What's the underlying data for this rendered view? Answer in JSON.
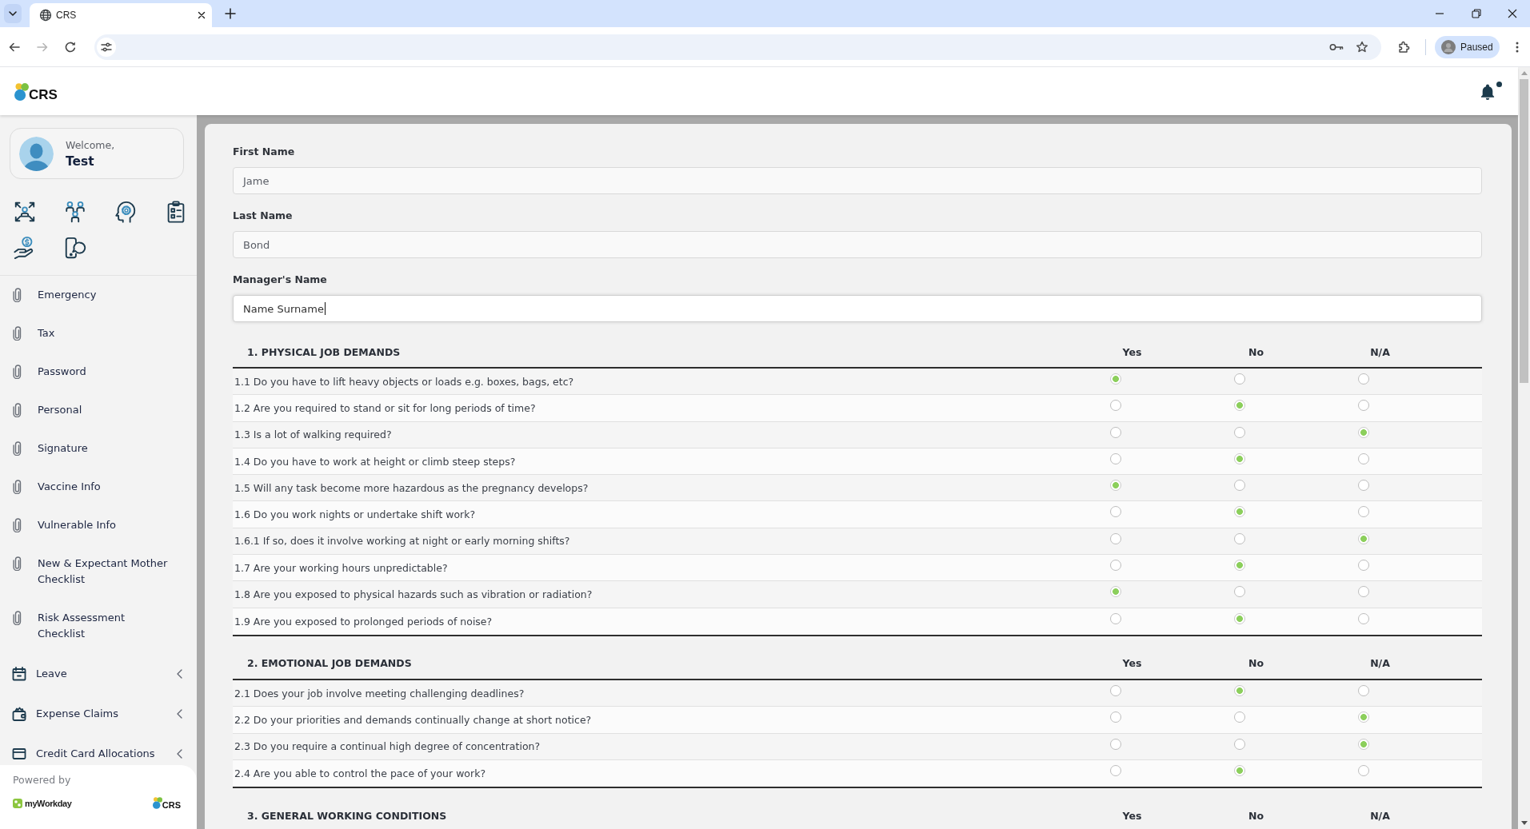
{
  "browser": {
    "tabs": [
      {
        "title": "CRS",
        "selected": true
      }
    ],
    "forward_disabled": true,
    "profile": {
      "status": "Paused"
    }
  },
  "header": {
    "logo": "CRS",
    "notifications": {
      "unread": true
    }
  },
  "sidebar": {
    "welcome": {
      "greeting": "Welcome,",
      "name": "Test"
    },
    "items": [
      {
        "kind": "attachment",
        "label": "Emergency"
      },
      {
        "kind": "attachment",
        "label": "Tax"
      },
      {
        "kind": "attachment",
        "label": "Password"
      },
      {
        "kind": "attachment",
        "label": "Personal"
      },
      {
        "kind": "attachment",
        "label": "Signature"
      },
      {
        "kind": "attachment",
        "label": "Vaccine Info"
      },
      {
        "kind": "attachment",
        "label": "Vulnerable Info"
      },
      {
        "kind": "attachment",
        "label": "New & Expectant Mother Checklist"
      },
      {
        "kind": "attachment",
        "label": "Risk Assessment Checklist"
      },
      {
        "kind": "group",
        "label": "Leave",
        "expanded": false
      },
      {
        "kind": "group",
        "label": "Expense Claims",
        "expanded": false
      },
      {
        "kind": "group",
        "label": "Credit Card Allocations",
        "expanded": false
      }
    ],
    "footer": {
      "caption": "Powered by",
      "partner": "myWorkday",
      "logo": "CRS"
    }
  },
  "form": {
    "fields": [
      {
        "label": "First Name",
        "value": "Jame",
        "readonly": true,
        "focused": false
      },
      {
        "label": "Last Name",
        "value": "Bond",
        "readonly": true,
        "focused": false
      },
      {
        "label": "Manager's Name",
        "value": "Name Surname",
        "readonly": false,
        "focused": true
      }
    ],
    "sections": [
      {
        "title": "1. PHYSICAL JOB DEMANDS",
        "columns": [
          "Yes",
          "No",
          "N/A"
        ],
        "questions": [
          {
            "text": "1.1 Do you have to lift heavy objects or loads e.g. boxes, bags, etc?",
            "choices": [
              {
                "selected": true
              },
              {
                "selected": false
              },
              {
                "selected": false
              }
            ]
          },
          {
            "text": "1.2 Are you required to stand or sit for long periods of time?",
            "choices": [
              {
                "selected": false
              },
              {
                "selected": true
              },
              {
                "selected": false
              }
            ]
          },
          {
            "text": "1.3 Is a lot of walking required?",
            "choices": [
              {
                "selected": false
              },
              {
                "selected": false
              },
              {
                "selected": true
              }
            ]
          },
          {
            "text": "1.4 Do you have to work at height or climb steep steps?",
            "choices": [
              {
                "selected": false
              },
              {
                "selected": true
              },
              {
                "selected": false
              }
            ]
          },
          {
            "text": "1.5 Will any task become more hazardous as the pregnancy develops?",
            "choices": [
              {
                "selected": true
              },
              {
                "selected": false
              },
              {
                "selected": false
              }
            ]
          },
          {
            "text": "1.6 Do you work nights or undertake shift work?",
            "choices": [
              {
                "selected": false
              },
              {
                "selected": true
              },
              {
                "selected": false
              }
            ]
          },
          {
            "text": "1.6.1 If so, does it involve working at night or early morning shifts?",
            "choices": [
              {
                "selected": false
              },
              {
                "selected": false
              },
              {
                "selected": true
              }
            ]
          },
          {
            "text": "1.7 Are your working hours unpredictable?",
            "choices": [
              {
                "selected": false
              },
              {
                "selected": true
              },
              {
                "selected": false
              }
            ]
          },
          {
            "text": "1.8 Are you exposed to physical hazards such as vibration or radiation?",
            "choices": [
              {
                "selected": true
              },
              {
                "selected": false
              },
              {
                "selected": false
              }
            ]
          },
          {
            "text": "1.9 Are you exposed to prolonged periods of noise?",
            "choices": [
              {
                "selected": false
              },
              {
                "selected": true
              },
              {
                "selected": false
              }
            ]
          }
        ]
      },
      {
        "title": "2. EMOTIONAL JOB DEMANDS",
        "columns": [
          "Yes",
          "No",
          "N/A"
        ],
        "questions": [
          {
            "text": "2.1 Does your job involve meeting challenging deadlines?",
            "choices": [
              {
                "selected": false
              },
              {
                "selected": true
              },
              {
                "selected": false
              }
            ]
          },
          {
            "text": "2.2 Do your priorities and demands continually change at short notice?",
            "choices": [
              {
                "selected": false
              },
              {
                "selected": false
              },
              {
                "selected": true
              }
            ]
          },
          {
            "text": "2.3 Do you require a continual high degree of concentration?",
            "choices": [
              {
                "selected": false
              },
              {
                "selected": false
              },
              {
                "selected": true
              }
            ]
          },
          {
            "text": "2.4 Are you able to control the pace of your work?",
            "choices": [
              {
                "selected": false
              },
              {
                "selected": true
              },
              {
                "selected": false
              }
            ]
          }
        ]
      },
      {
        "title": "3. GENERAL WORKING CONDITIONS",
        "columns": [
          "Yes",
          "No",
          "N/A"
        ]
      }
    ]
  }
}
